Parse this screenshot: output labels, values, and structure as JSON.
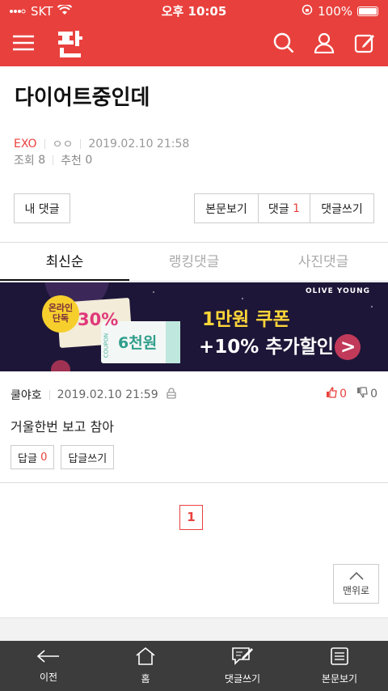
{
  "status_bar": {
    "carrier": "SKT",
    "time": "오후 10:05",
    "battery": "100%"
  },
  "post": {
    "title": "다이어트중인데",
    "author": "EXO",
    "name_symbols": "ㅇㅇ",
    "datetime": "2019.02.10 21:58",
    "views_label": "조회",
    "views": "8",
    "recommend_label": "추천",
    "recommend": "0"
  },
  "actions": {
    "my_comments": "내 댓글",
    "view_article": "본문보기",
    "comments_label": "댓글",
    "comments_count": "1",
    "write_comment": "댓글쓰기"
  },
  "tabs": [
    {
      "label": "최신순",
      "active": true
    },
    {
      "label": "랭킹댓글",
      "active": false
    },
    {
      "label": "사진댓글",
      "active": false
    }
  ],
  "banner": {
    "badge": "온라인 단독",
    "coupon_big": "30%",
    "coupon_small": "6천원",
    "coupon_side": "COUPON",
    "brand": "OLIVE YOUNG",
    "headline1": "1만원 쿠폰",
    "headline2": "+10% 추가할인 >"
  },
  "comment": {
    "nickname": "쿨야호",
    "datetime": "2019.02.10 21:59",
    "up": "0",
    "down": "0",
    "body": "거울한번 보고 참아",
    "reply_label": "답글",
    "reply_count": "0",
    "write_reply": "답글쓰기"
  },
  "pagination": {
    "current": "1"
  },
  "to_top": "맨위로",
  "bottom_nav": [
    {
      "label": "이전",
      "icon": "back-arrow-icon"
    },
    {
      "label": "홈",
      "icon": "home-icon"
    },
    {
      "label": "댓글쓰기",
      "icon": "write-comment-icon"
    },
    {
      "label": "본문보기",
      "icon": "document-icon"
    }
  ],
  "colors": {
    "brand_red": "#e8413d",
    "nav_dark": "#3c3c3c"
  }
}
